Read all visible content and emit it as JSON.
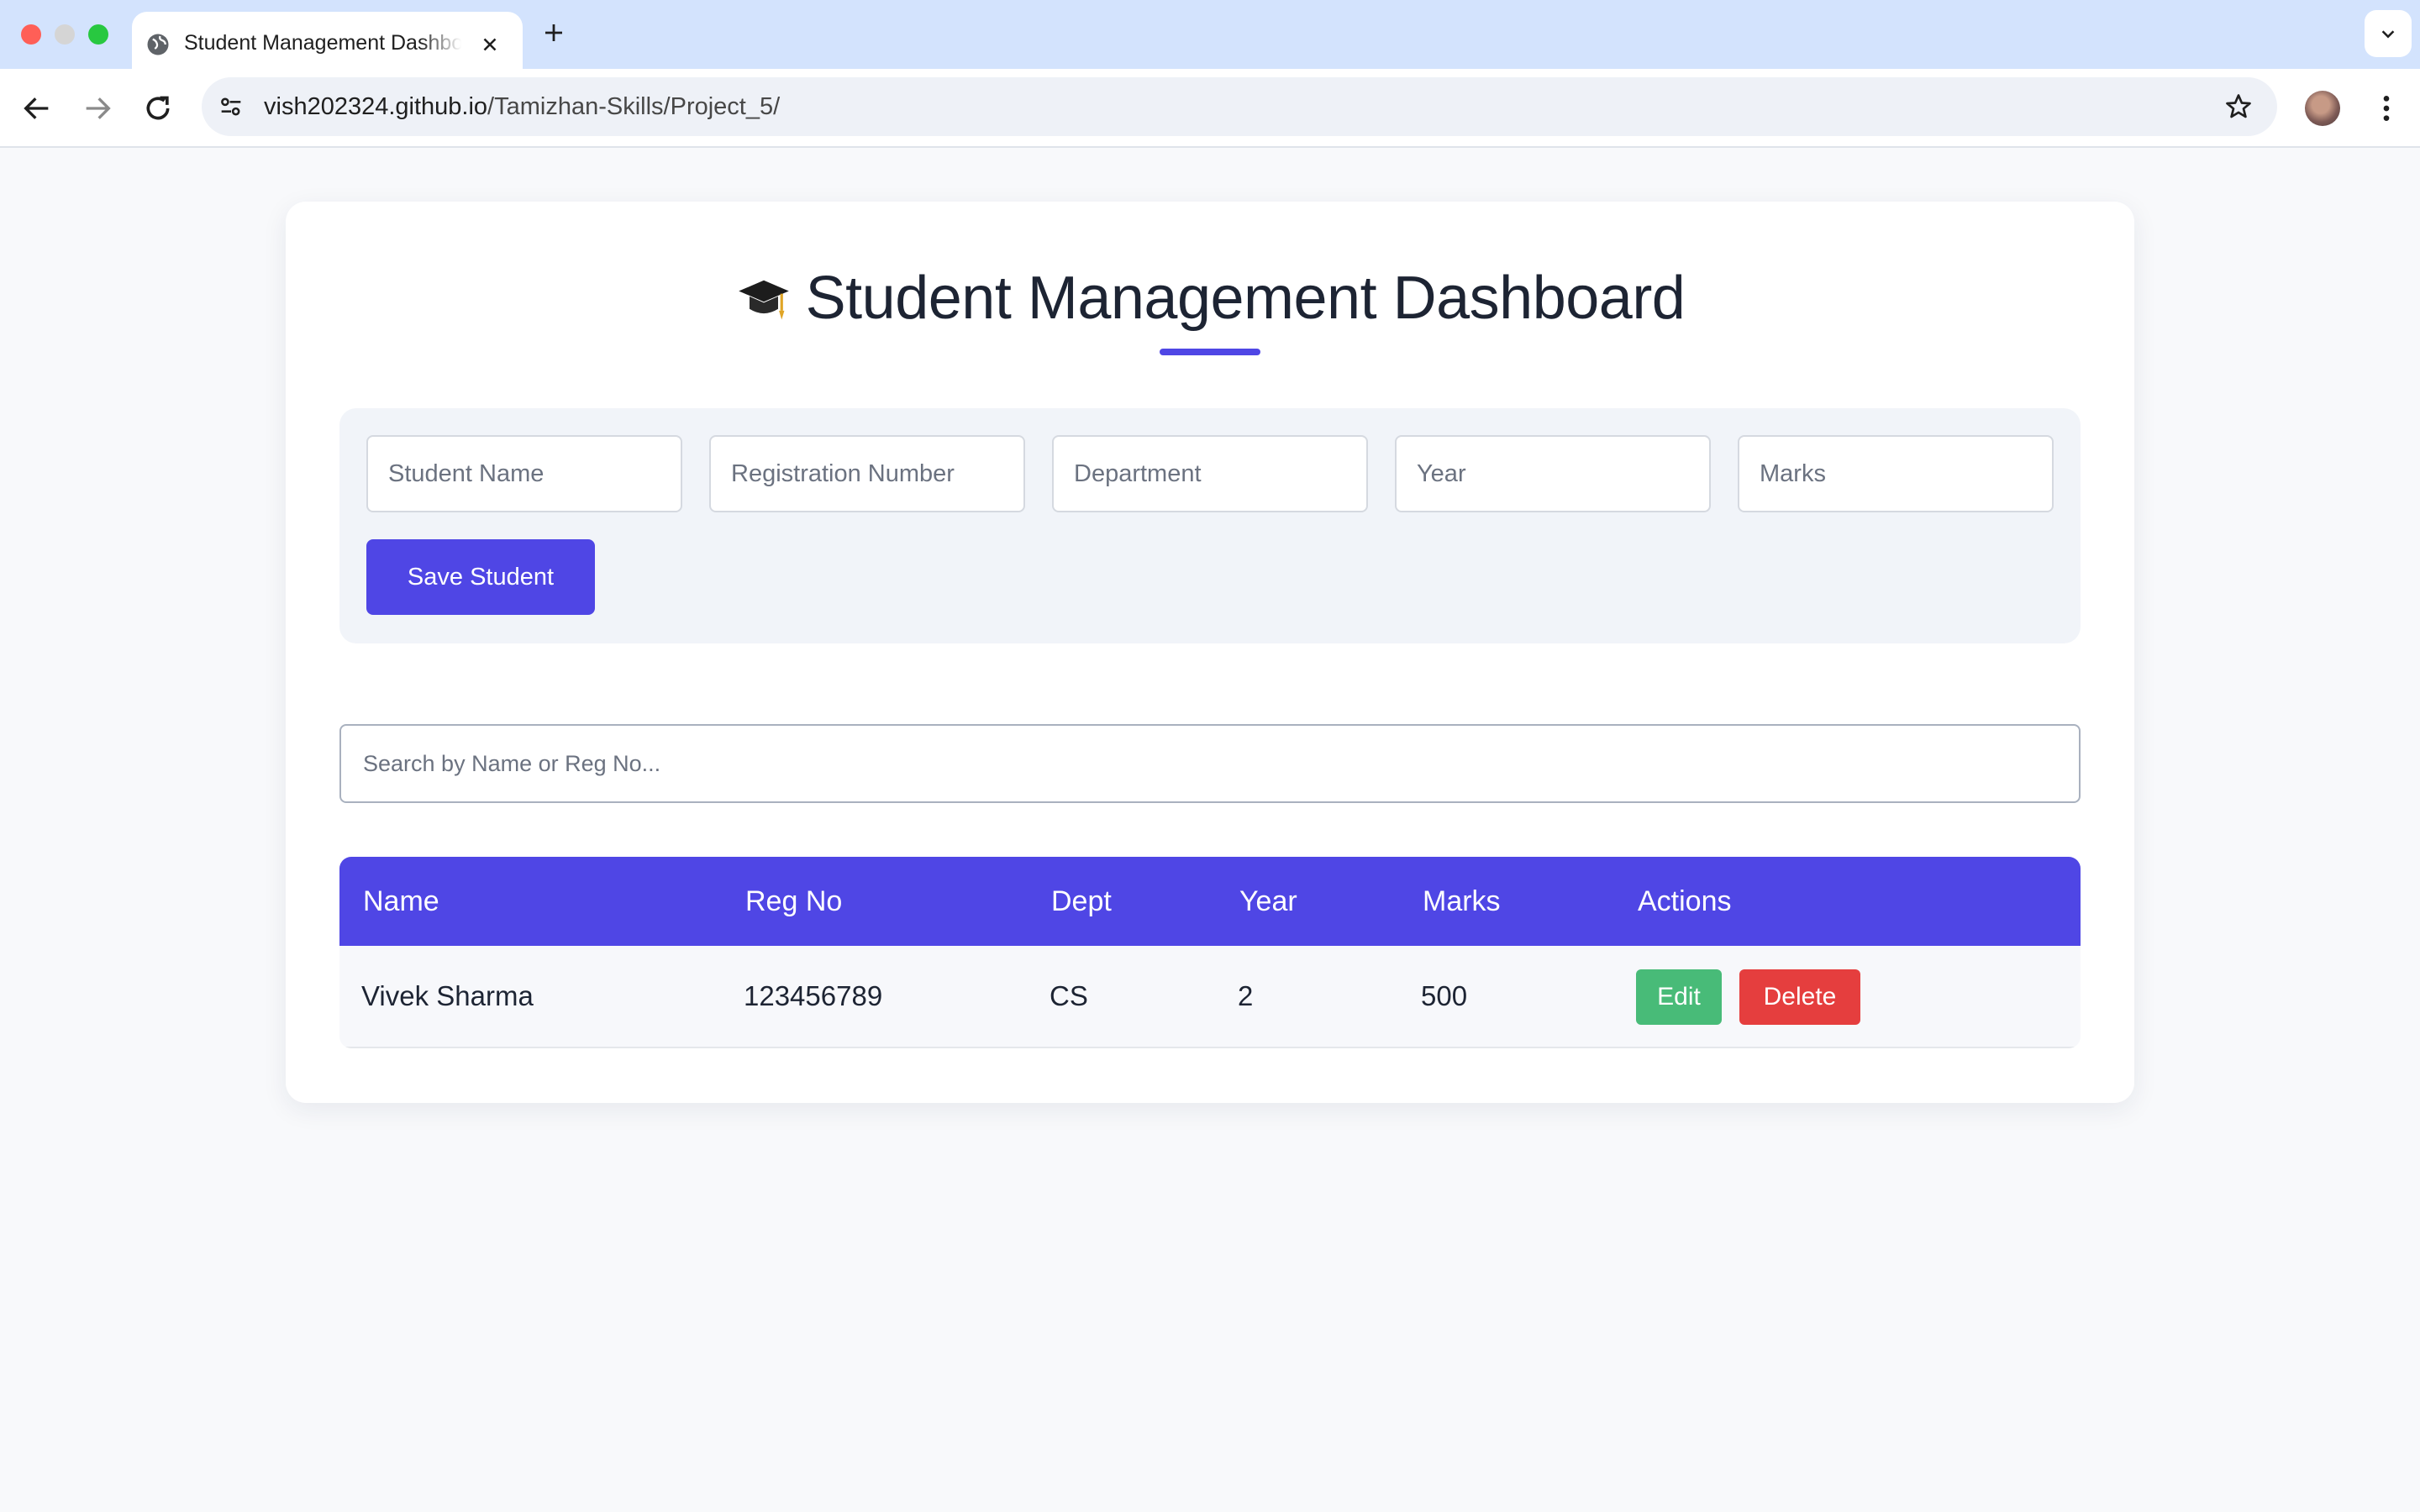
{
  "browser": {
    "tab_title": "Student Management Dashboard",
    "url_host": "vish202324.github.io",
    "url_path": "/Tamizhan-Skills/Project_5/"
  },
  "page": {
    "title": "Student Management Dashboard",
    "title_icon": "graduation-cap-icon",
    "accent_color": "#4f46e5"
  },
  "form": {
    "name_placeholder": "Student Name",
    "reg_placeholder": "Registration Number",
    "dept_placeholder": "Department",
    "year_placeholder": "Year",
    "marks_placeholder": "Marks",
    "save_label": "Save Student"
  },
  "search": {
    "placeholder": "Search by Name or Reg No..."
  },
  "table": {
    "headers": [
      "Name",
      "Reg No",
      "Dept",
      "Year",
      "Marks",
      "Actions"
    ],
    "rows": [
      {
        "name": "Vivek Sharma",
        "reg_no": "123456789",
        "dept": "CS",
        "year": "2",
        "marks": "500",
        "edit_label": "Edit",
        "delete_label": "Delete"
      }
    ],
    "edit_color": "#48bb78",
    "delete_color": "#e53e3e"
  }
}
